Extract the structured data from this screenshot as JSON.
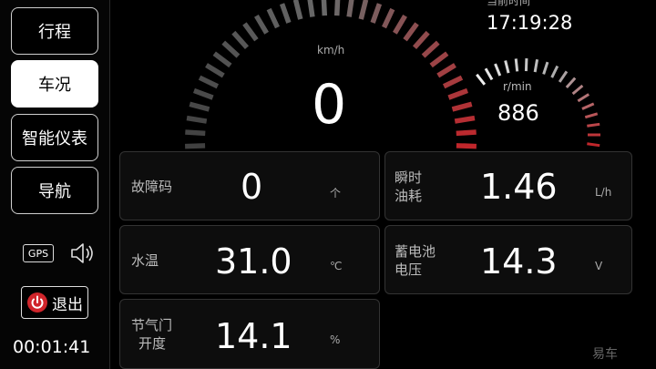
{
  "sidebar": {
    "items": [
      {
        "label": "行程",
        "active": false
      },
      {
        "label": "车况",
        "active": true
      },
      {
        "label": "智能仪表",
        "active": false
      },
      {
        "label": "导航",
        "active": false
      }
    ],
    "gps_label": "GPS",
    "exit_label": "退出",
    "elapsed": "00:01:41"
  },
  "speed": {
    "unit": "km/h",
    "value": "0"
  },
  "rpm": {
    "unit": "r/min",
    "value": "886"
  },
  "clock": {
    "label": "当前时间",
    "value": "17:19:28"
  },
  "cards": {
    "fault": {
      "label": "故障码",
      "value": "0",
      "unit": "个"
    },
    "fuel": {
      "label1": "瞬时",
      "label2": "油耗",
      "value": "1.46",
      "unit": "L/h"
    },
    "water": {
      "label": "水温",
      "value": "31.0",
      "unit": "℃"
    },
    "battery": {
      "label1": "蓄电池",
      "label2": "电压",
      "value": "14.3",
      "unit": "V"
    },
    "throttle": {
      "label1": "节气门",
      "label2": "开度",
      "value": "14.1",
      "unit": "%"
    }
  },
  "watermark": "易车",
  "colors": {
    "accent_red": "#c0262b",
    "active_bg": "#ffffff"
  }
}
